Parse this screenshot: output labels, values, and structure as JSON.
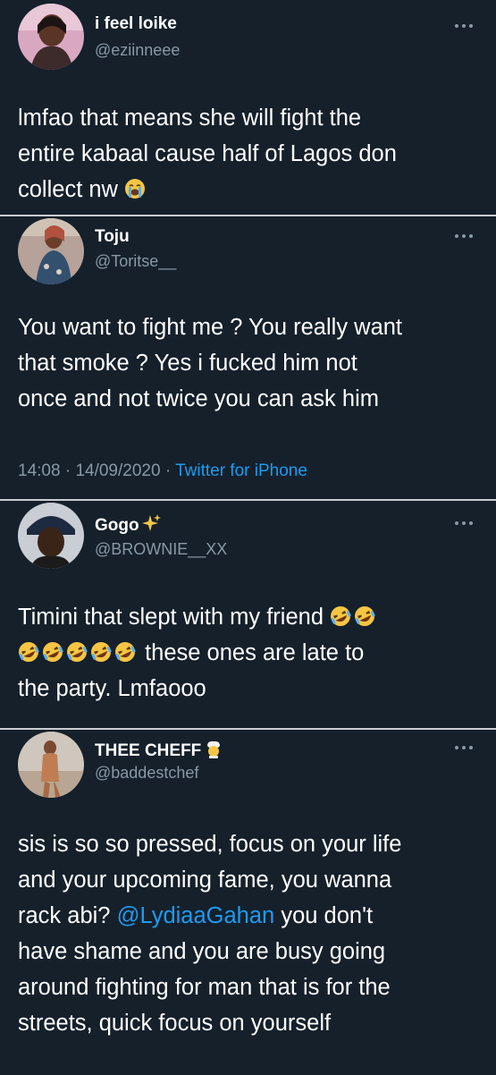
{
  "tweets": [
    {
      "name": "i feel loike",
      "handle": "@eziinneee",
      "menu_icon": "more-options-icon",
      "lines": [
        "lmfao that means she will fight the",
        "entire kabaal cause half of Lagos don",
        "collect nw"
      ],
      "emoji": "loudly-crying-face"
    },
    {
      "name": "Toju",
      "handle": "@Toritse__",
      "lines": [
        "You want to fight me ? You really want",
        "that smoke ? Yes i fucked him not",
        "once and not twice you can ask him"
      ],
      "time": "14:08",
      "date": "14/09/2020",
      "separator": "·",
      "source": "Twitter for iPhone"
    },
    {
      "name": "Gogo",
      "name_emoji": "sparkles",
      "handle": "@BROWNIE__XX",
      "lines": [
        "Timini that slept with my friend",
        "these ones are late to",
        "the party. Lmfaooo"
      ],
      "emoji": "rolling-on-floor-laughing"
    },
    {
      "name": "THEE CHEFF",
      "name_emoji": "cook",
      "handle": "@baddestchef",
      "lines_before_mention": [
        "sis is so so pressed, focus on your life",
        "and your upcoming fame, you wanna",
        "rack abi?"
      ],
      "mention": "@LydiaaGahan",
      "mention_tail": "you don't",
      "lines_after_mention": [
        "have shame and you are busy going",
        "around fighting for man that is for the",
        "streets, quick focus on yourself"
      ]
    }
  ],
  "colors": {
    "background": "#15202b",
    "text": "#ffffff",
    "secondary": "#8899a6",
    "link": "#1d9bf0",
    "divider": "#c9cdd1"
  }
}
